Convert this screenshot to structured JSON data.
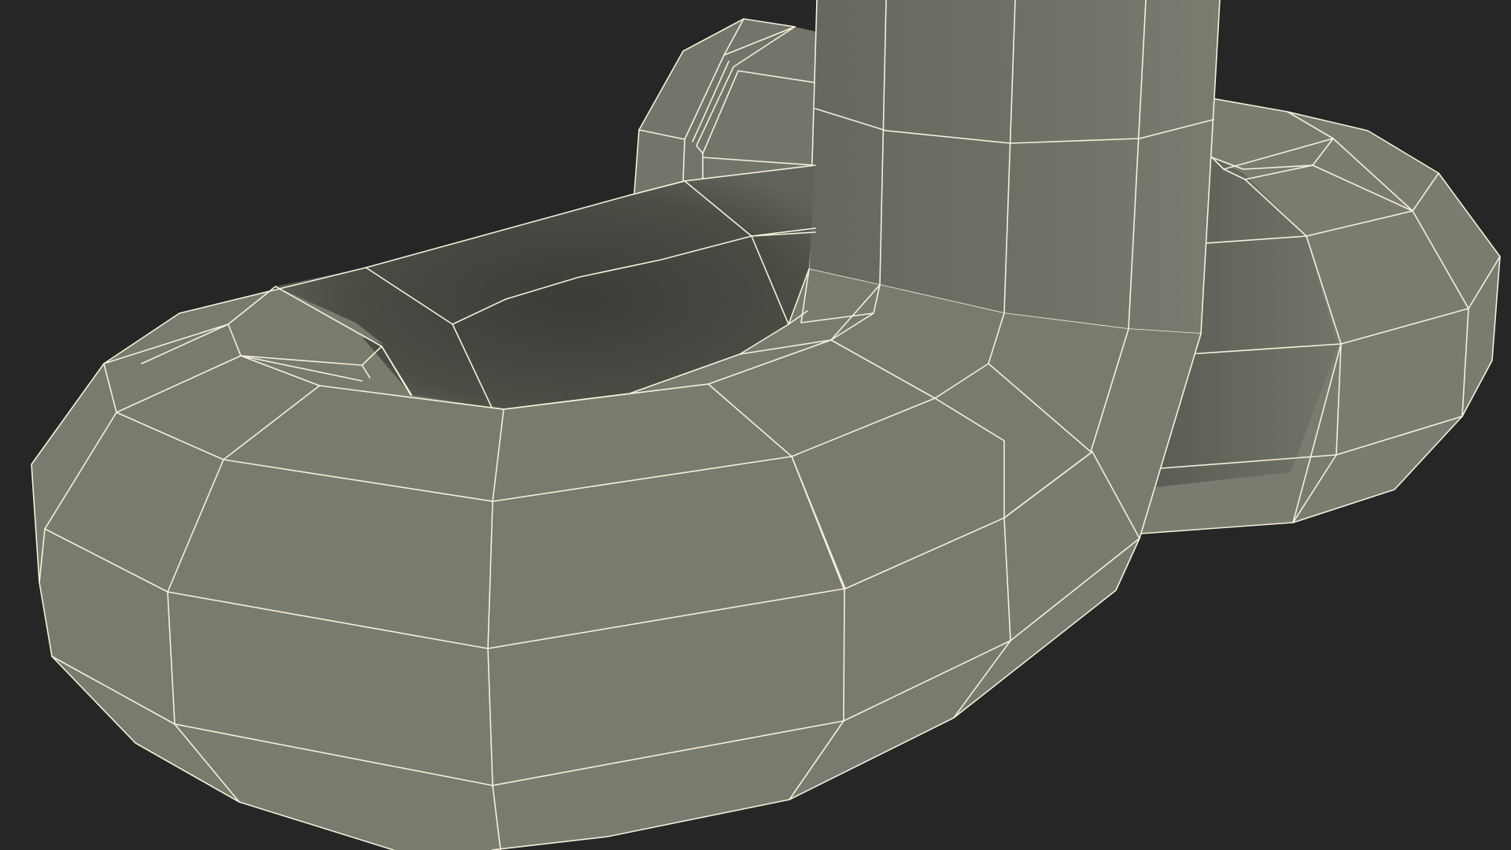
{
  "scene": {
    "background_color": "#262626",
    "object": "shackle-wireframe-render",
    "mesh_fill_color": "#7b7c70",
    "mesh_shadow_color": "#3f403a",
    "wireframe_color": "#f4f1dc"
  }
}
